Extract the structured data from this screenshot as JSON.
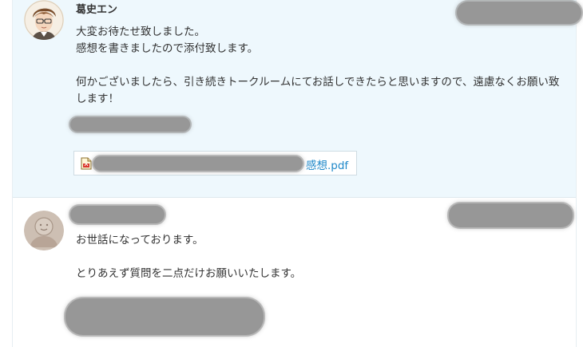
{
  "messages": [
    {
      "sender": "葛史エン",
      "body": "大変お待たせ致しました。\n感想を書きましたので添付致します。\n\n何かございましたら、引き続きトークルームにてお話しできたらと思いますので、遠慮なくお願い致します！",
      "attachment": {
        "filename": "感想.pdf",
        "icon": "pdf-file-icon"
      },
      "avatar": "illustrated-avatar"
    },
    {
      "sender": "",
      "body": "お世話になっております。\n\nとりあえず質問を二点だけお願いいたします。",
      "avatar": "default-user-avatar-icon"
    }
  ],
  "colors": {
    "highlight_bg": "#eef8fd",
    "link": "#1f88c9",
    "redaction": "#979797"
  }
}
